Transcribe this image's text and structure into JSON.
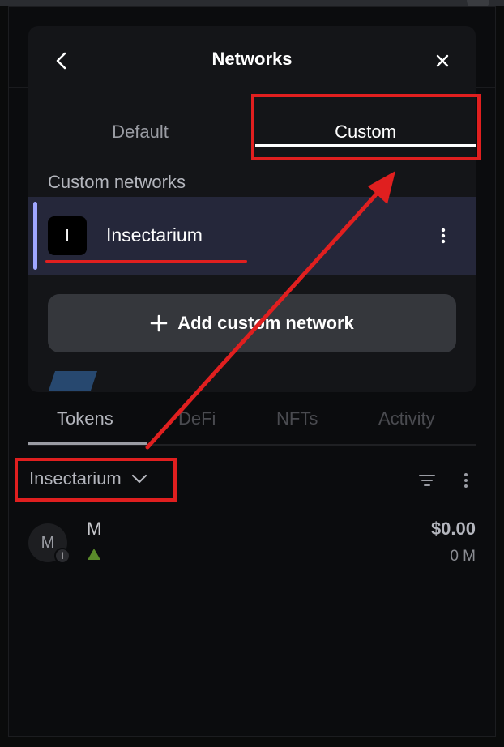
{
  "modal": {
    "title": "Networks",
    "tabs": [
      {
        "label": "Default",
        "active": false
      },
      {
        "label": "Custom",
        "active": true
      }
    ],
    "section_label": "Custom networks",
    "networks": [
      {
        "avatar_letter": "I",
        "name": "Insectarium",
        "selected": true
      }
    ],
    "add_button_label": "Add custom network"
  },
  "main": {
    "tabs": [
      {
        "label": "Tokens",
        "active": true
      },
      {
        "label": "DeFi",
        "active": false
      },
      {
        "label": "NFTs",
        "active": false
      },
      {
        "label": "Activity",
        "active": false
      }
    ],
    "network_selector": "Insectarium",
    "tokens": [
      {
        "avatar_letter": "M",
        "badge_letter": "I",
        "name": "M",
        "value": "$0.00",
        "quantity": "0 M",
        "trend_color": "#5a8a2a"
      }
    ]
  },
  "colors": {
    "accent": "#9fa6ff",
    "annotation": "#e01f1f",
    "selected_row": "#25273a"
  },
  "icons": [
    "back-arrow-icon",
    "close-icon",
    "kebab-menu-icon",
    "plus-icon",
    "chevron-down-icon",
    "filter-icon",
    "triangle-up-icon"
  ]
}
